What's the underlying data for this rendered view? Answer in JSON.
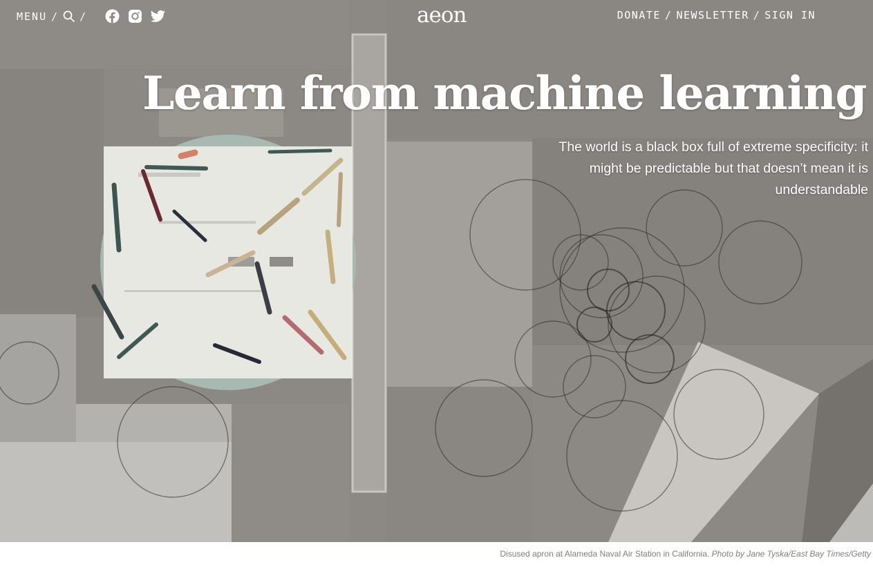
{
  "nav": {
    "menu_label": "MENU",
    "separator": "/",
    "icons": [
      "search-icon",
      "facebook-icon",
      "instagram-icon",
      "twitter-icon"
    ],
    "logo": "aeon",
    "right_links": [
      "DONATE",
      "NEWSLETTER",
      "SIGN IN"
    ]
  },
  "article": {
    "title": "Learn from machine learning",
    "standfirst": "The world is a black box full of extreme specificity: it might be predictable but that doesn’t mean it is understandable"
  },
  "caption": {
    "text": "Disused apron at Alameda Naval Air Station in California.",
    "credit": "Photo by Jane Tyska/East Bay Times/Getty"
  },
  "colors": {
    "text_on_image": "#ffffff",
    "caption": "#808080"
  }
}
